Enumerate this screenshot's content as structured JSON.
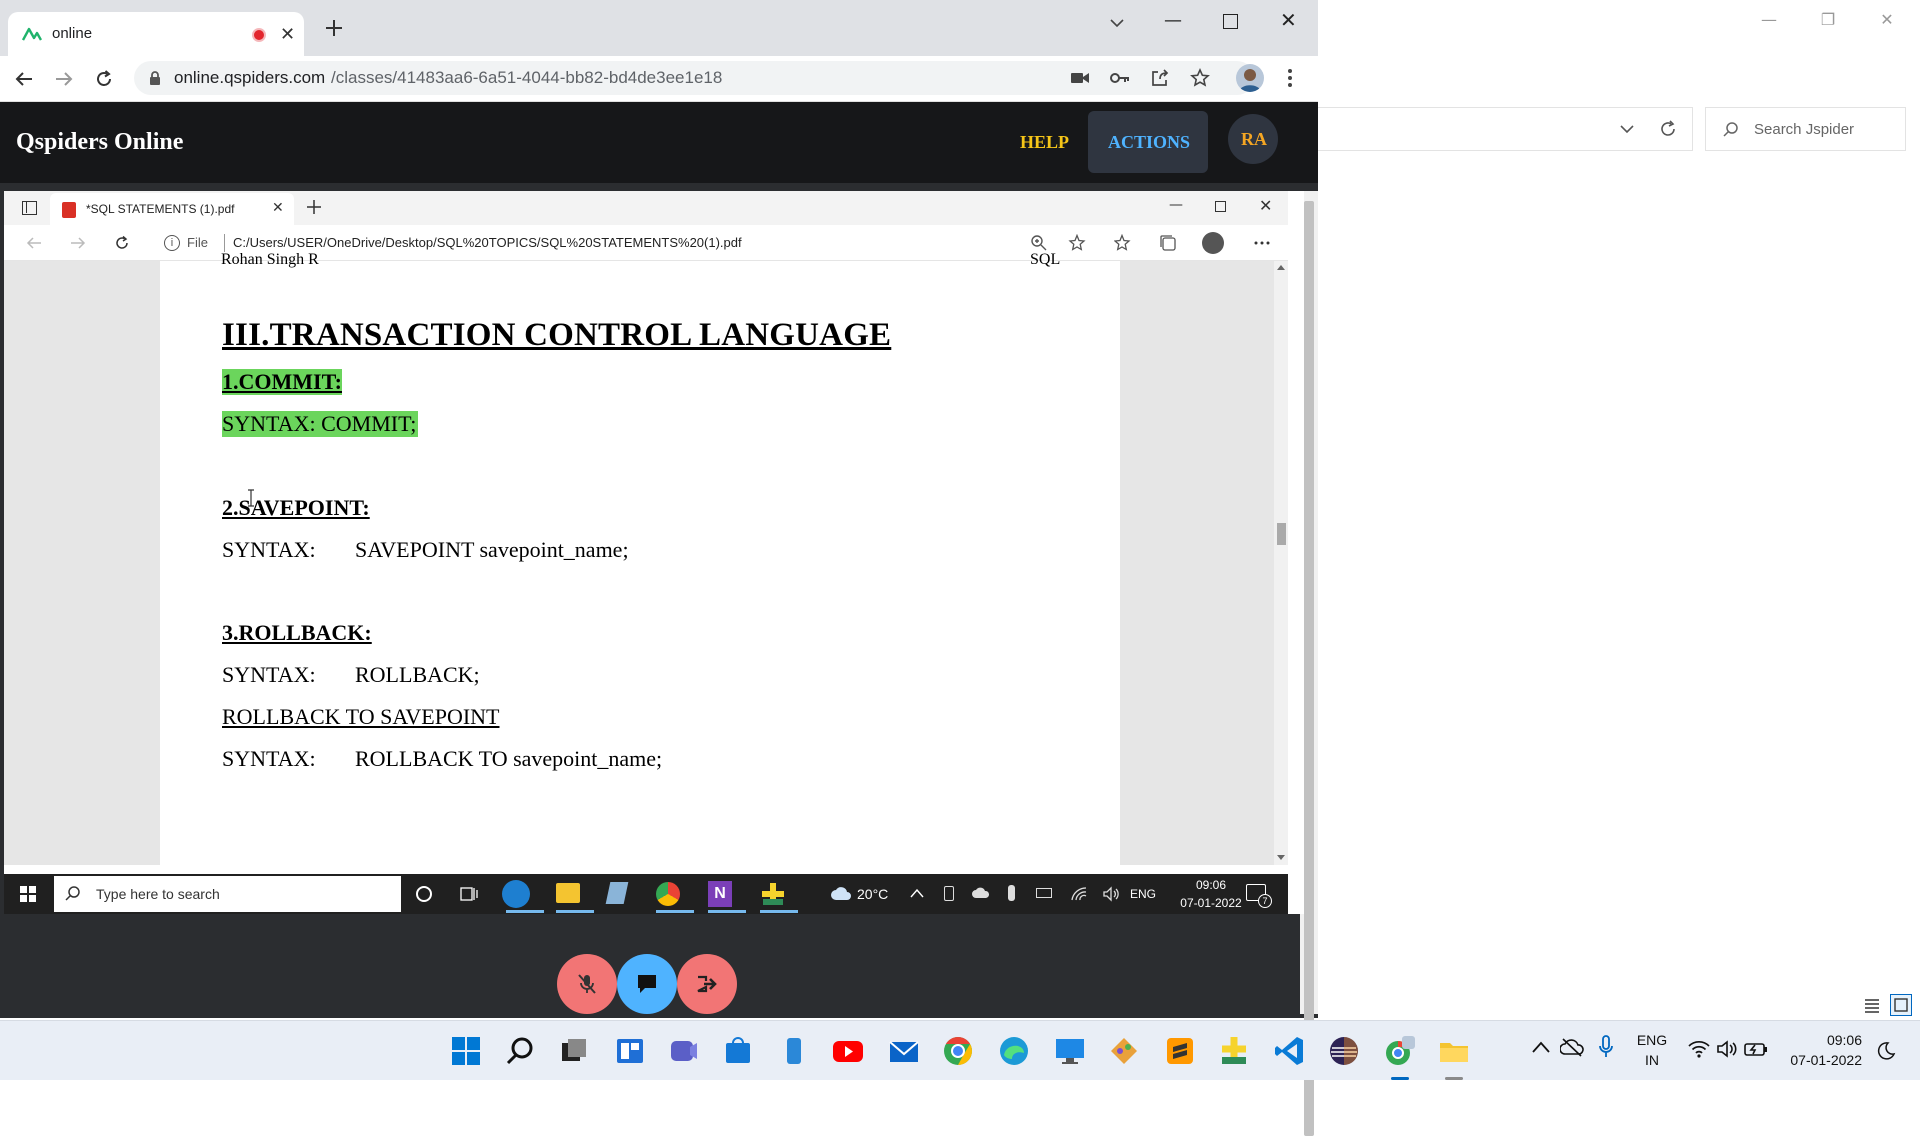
{
  "chrome": {
    "tab_title": "online",
    "url_host": "online.qspiders.com",
    "url_path": "/classes/41483aa6-6a51-4044-bb82-bd4de3ee1e18"
  },
  "site": {
    "brand": "Qspiders Online",
    "help_label": "HELP",
    "actions_label": "ACTIONS",
    "avatar_initials": "RA"
  },
  "explorer": {
    "search_placeholder": "Search Jspider"
  },
  "edge": {
    "tab_title": "*SQL STATEMENTS (1).pdf",
    "file_label": "File",
    "path": "C:/Users/USER/OneDrive/Desktop/SQL%20TOPICS/SQL%20STATEMENTS%20(1).pdf"
  },
  "pdf": {
    "header_left": "Rohan Singh R",
    "header_right": "SQL",
    "title": "III.TRANSACTION CONTROL  LANGUAGE",
    "commit_heading": "1.COMMIT:",
    "commit_syntax": "SYNTAX:  COMMIT;",
    "savepoint_heading": "2.SAVEPOINT:",
    "savepoint_label": "SYNTAX:",
    "savepoint_code": "SAVEPOINT savepoint_name;",
    "rollback_heading": "3.ROLLBACK:",
    "rollback_label": "SYNTAX:",
    "rollback_code": "ROLLBACK;",
    "rollback_to_heading": "ROLLBACK TO SAVEPOINT",
    "rollback_to_label": "SYNTAX:",
    "rollback_to_code": "ROLLBACK TO savepoint_name;"
  },
  "inner_taskbar": {
    "search_placeholder": "Type here to search",
    "weather": "20°C",
    "lang": "ENG",
    "time": "09:06",
    "date": "07-01-2022",
    "notification_count": "7"
  },
  "taskbar": {
    "lang_line1": "ENG",
    "lang_line2": "IN",
    "time": "09:06",
    "date": "07-01-2022"
  },
  "colors": {
    "site_header_bg": "#161719",
    "help": "#f5c518",
    "actions": "#4fb3ff",
    "avatar_bg": "#2f3540",
    "avatar_text": "#f5a623",
    "highlight": "#6bd55c",
    "mic_button": "#f27575",
    "chat_button": "#4fb3ff",
    "leave_button": "#f27575"
  }
}
